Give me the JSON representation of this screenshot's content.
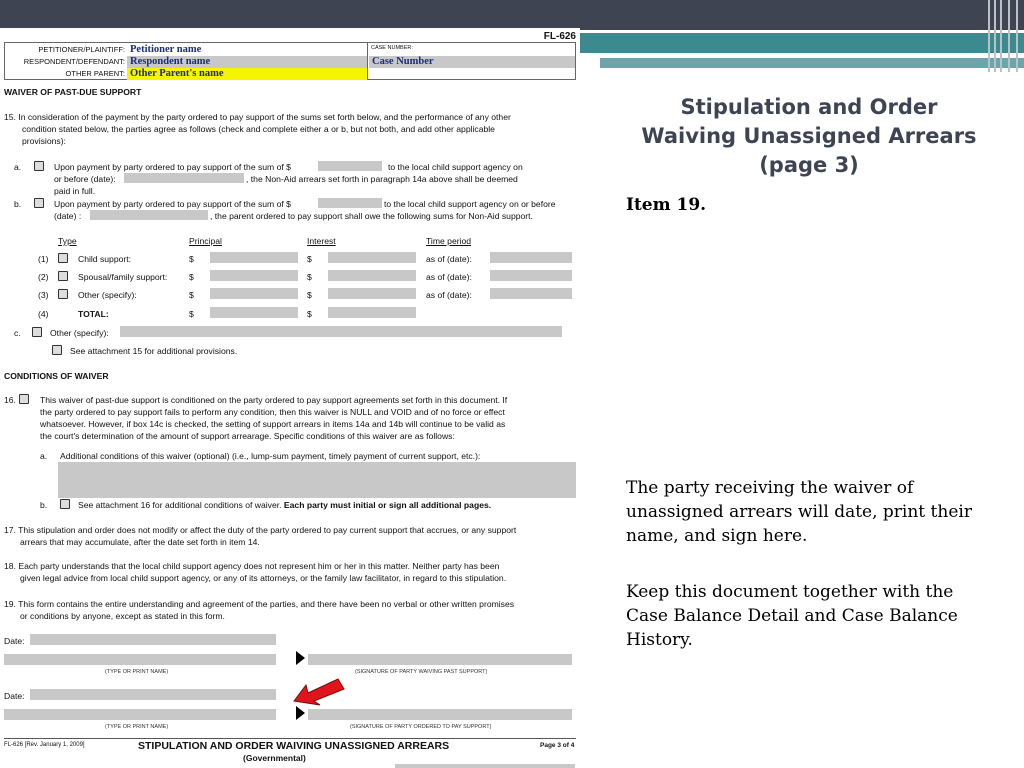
{
  "slide": {
    "title_lines": [
      "Stipulation and Order",
      "Waiving Unassigned Arrears",
      "(page 3)"
    ],
    "item_label": "Item 19.",
    "paragraph1": "The party receiving the waiver of unassigned arrears will date, print their name, and sign here.",
    "paragraph2": "Keep this document together with the Case Balance Detail and Case Balance History.",
    "colors": {
      "header_bar": "#3f4453",
      "accent_teal": "#3c8a8f",
      "title_text": "#3f4453",
      "arrow": "#e0141c"
    }
  },
  "doc": {
    "form_code": "FL-626",
    "caption": {
      "petitioner_label": "PETITIONER/PLAINTIFF:",
      "petitioner_value": "Petitioner name",
      "respondent_label": "RESPONDENT/DEFENDANT:",
      "respondent_value": "Respondent name",
      "other_label": "OTHER PARENT:",
      "other_value": "Other Parent's name",
      "case_label": "CASE NUMBER:",
      "case_value": "Case Number"
    },
    "waiver_heading": "WAIVER OF PAST-DUE SUPPORT",
    "item15_l1": "15.  In consideration of the payment by the party ordered to pay support of the sums set forth below, and the performance of any other",
    "item15_l2": "condition stated below, the parties agree as follows (check and complete either a or b, but not both, and add other applicable",
    "item15_l3": "provisions):",
    "a_label": "a.",
    "a_l1": "Upon payment by party ordered to pay support of the sum of $",
    "a_l1b": "to the local child support agency on",
    "a_l2": "or before (date):",
    "a_l2b": ", the Non-Aid arrears set forth in paragraph 14a above shall be deemed",
    "a_l3": "paid in full.",
    "b_label": "b.",
    "b_l1": "Upon payment by party ordered to pay support of the sum of $",
    "b_l1b": "to the local child support agency on or before",
    "b_l2": "(date) :",
    "b_l2b": ", the parent ordered to pay support shall owe the following sums for Non-Aid support.",
    "table_headers": [
      "Type",
      "Principal",
      "Interest",
      "Time period"
    ],
    "table_rows": [
      {
        "num": "(1)",
        "type": "Child support:",
        "p": "$",
        "i": "$",
        "t": "as of (date):"
      },
      {
        "num": "(2)",
        "type": "Spousal/family support:",
        "p": "$",
        "i": "$",
        "t": "as of (date):"
      },
      {
        "num": "(3)",
        "type": "Other (specify):",
        "p": "$",
        "i": "$",
        "t": "as of (date):"
      },
      {
        "num": "(4)",
        "type": "TOTAL:",
        "p": "$",
        "i": "$",
        "t": ""
      }
    ],
    "c_label": "c.",
    "c_text": "Other (specify):",
    "attach15": "See attachment 15 for additional provisions.",
    "conditions_heading": "CONDITIONS OF WAIVER",
    "item16_num": "16.",
    "item16_l1": "This waiver of past-due support is conditioned on the party ordered to pay support agreements set forth in this document. If",
    "item16_l2": "the party ordered to pay support fails to perform any condition, then this waiver is NULL and VOID and of no force or effect",
    "item16_l3": "whatsoever. However, if box 14c is checked, the setting of support arrears in items 14a and 14b will continue to be valid as",
    "item16_l4": "the court's determination of the amount of support arrearage. Specific conditions of this waiver are as follows:",
    "i16a_label": "a.",
    "i16a_text": "Additional conditions of this waiver (optional) (i.e., lump-sum payment, timely payment of current support, etc.):",
    "i16b_label": "b.",
    "i16b_text": "See attachment 16 for additional conditions of waiver.",
    "i16b_bold": "Each party must initial or sign all additional pages.",
    "item17_l1": "17. This stipulation and order does not modify or affect the duty of the party ordered to pay current support that accrues, or any support",
    "item17_l2": "arrears that may accumulate, after the date set forth in item 14.",
    "item18_l1": "18. Each party understands that the local child support agency does not represent him or her in this matter. Neither party has been",
    "item18_l2": "given legal advice from local child support agency, or any of its attorneys, or the family law facilitator, in regard to this stipulation.",
    "item19_l1": "19. This form contains the entire understanding and agreement of the parties, and there have been no verbal or other written promises",
    "item19_l2": "or conditions by anyone, except as stated in this form.",
    "date_label": "Date:",
    "type_print": "(TYPE OR PRINT NAME)",
    "sig_waiving": "(SIGNATURE OF PARTY WAIVING PAST SUPPORT)",
    "sig_ordered": "(SIGNATURE OF PARTY ORDERED TO PAY SUPPORT)",
    "footer_left": "FL-626 [Rev. January 1, 2009]",
    "footer_title": "STIPULATION AND ORDER WAIVING UNASSIGNED ARREARS",
    "footer_sub": "(Governmental)",
    "footer_page": "Page 3 of 4"
  }
}
